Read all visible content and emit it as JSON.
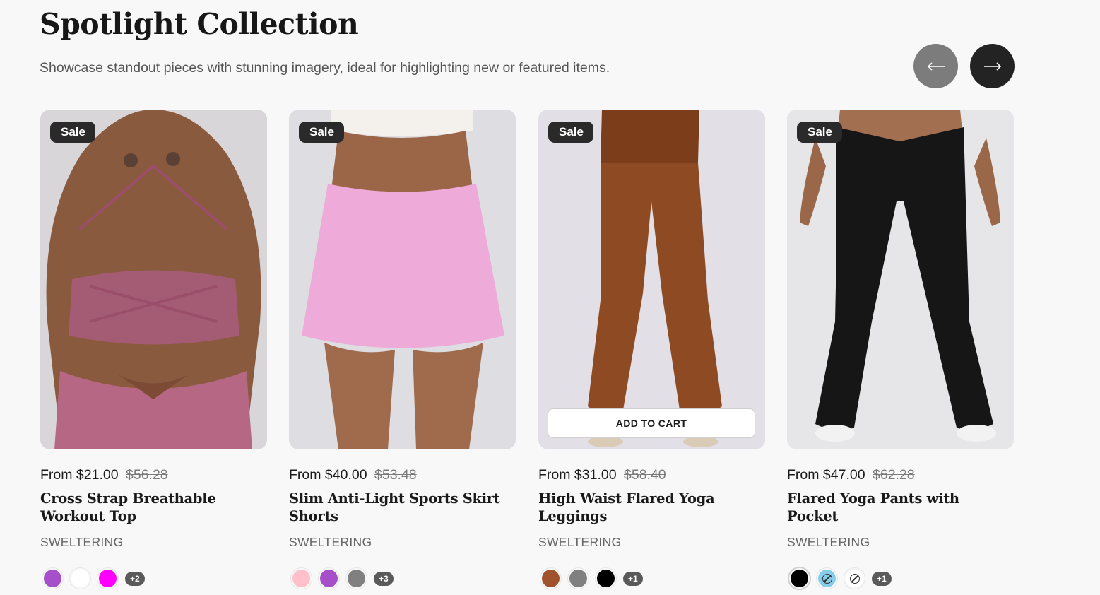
{
  "section": {
    "title": "Spotlight Collection",
    "subtitle": "Showcase standout pieces with stunning imagery, ideal for highlighting new or featured items.",
    "prev_icon": "arrow-left-icon",
    "next_icon": "arrow-right-icon"
  },
  "products": [
    {
      "badge": "Sale",
      "price_prefix": "From",
      "price": "$21.00",
      "compare_price": "$56.28",
      "name": "Cross Strap Breathable Workout Top",
      "vendor": "SWELTERING",
      "swatches": [
        "#a64fc9",
        "#ffffff",
        "#ff00ff"
      ],
      "more": "+2"
    },
    {
      "badge": "Sale",
      "price_prefix": "From",
      "price": "$40.00",
      "compare_price": "$53.48",
      "name": "Slim Anti-Light Sports Skirt Shorts",
      "vendor": "SWELTERING",
      "swatches": [
        "#ffc0cb",
        "#a64fc9",
        "#808080"
      ],
      "more": "+3"
    },
    {
      "badge": "Sale",
      "price_prefix": "From",
      "price": "$31.00",
      "compare_price": "$58.40",
      "name": "High Waist Flared Yoga Leggings",
      "vendor": "SWELTERING",
      "add_to_cart": "ADD TO CART",
      "swatches": [
        "#a0522d",
        "#808080",
        "#000000"
      ],
      "more": "+1"
    },
    {
      "badge": "Sale",
      "price_prefix": "From",
      "price": "$47.00",
      "compare_price": "$62.28",
      "name": "Flared Yoga Pants with Pocket",
      "vendor": "SWELTERING",
      "swatches": [
        "#000000",
        "#87ceeb",
        "#ffffff"
      ],
      "more": "+1"
    }
  ]
}
